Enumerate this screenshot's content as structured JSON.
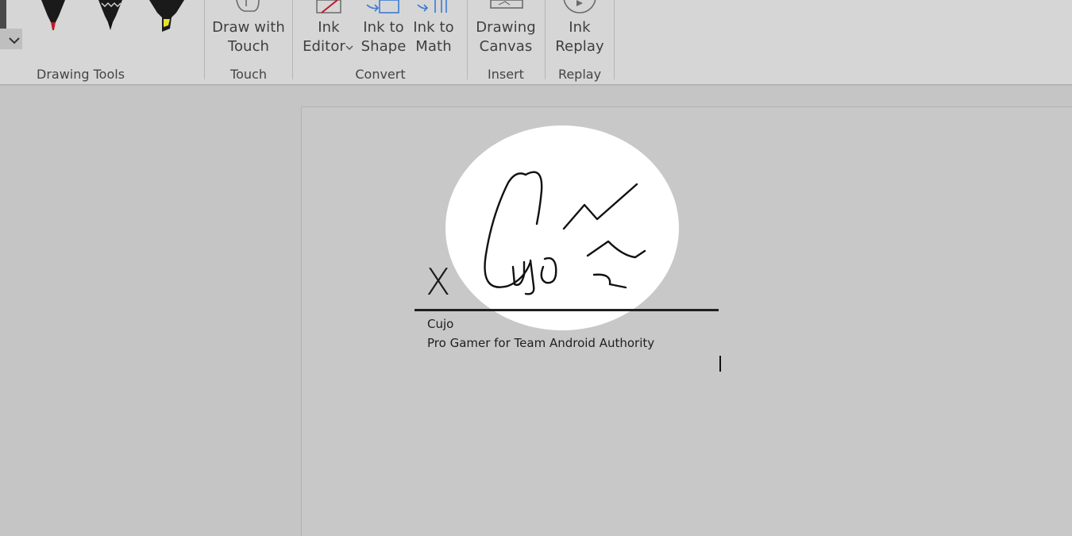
{
  "ribbon": {
    "groups": {
      "drawing_tools": "Drawing Tools",
      "touch": "Touch",
      "convert": "Convert",
      "insert": "Insert",
      "replay": "Replay"
    },
    "buttons": {
      "draw_with_touch": [
        "Draw with",
        "Touch"
      ],
      "ink_editor": [
        "Ink",
        "Editor"
      ],
      "ink_to_shape": [
        "Ink to",
        "Shape"
      ],
      "ink_to_math": [
        "Ink to",
        "Math"
      ],
      "drawing_canvas": [
        "Drawing",
        "Canvas"
      ],
      "ink_replay": [
        "Ink",
        "Replay"
      ]
    },
    "pens": [
      {
        "name": "red-pen",
        "color": "#c0192b"
      },
      {
        "name": "black-pen",
        "color": "#1a1a1a"
      },
      {
        "name": "yellow-highlighter",
        "color": "#e8e22a"
      }
    ]
  },
  "document": {
    "signature_marker": "X",
    "signer_name": "Cujo",
    "signer_title": "Pro Gamer for Team Android Authority"
  },
  "colors": {
    "ribbon_bg": "#d6d6d6",
    "canvas_bg": "#c5c5c6",
    "highlight": "#ffffff",
    "ink": "#111111"
  }
}
